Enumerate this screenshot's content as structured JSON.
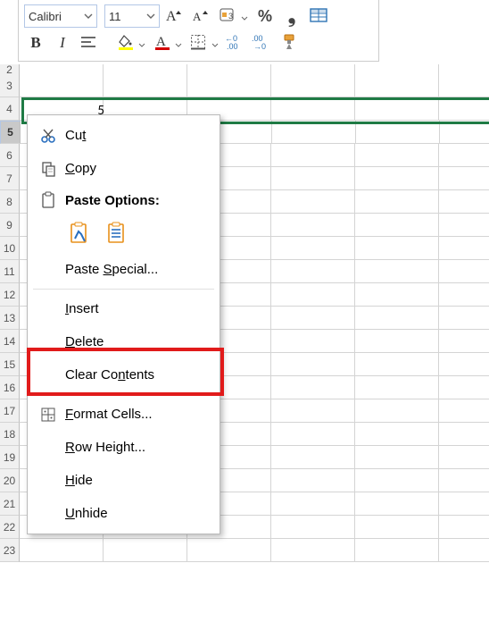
{
  "floatie": {
    "font": "Calibri",
    "size": "11",
    "boldGlyph": "B",
    "italicGlyph": "I",
    "percentGlyph": "%",
    "commaGlyph": "❟"
  },
  "rows": {
    "start": 2,
    "end": 23,
    "selected": 5
  },
  "selectedCellValue": "5",
  "menu": {
    "cut": "Cu<u>t</u>",
    "copy": "<u>C</u>opy",
    "pasteOptions": "Paste Options:",
    "pasteSpecial": "Paste <u>S</u>pecial...",
    "insert": "<u>I</u>nsert",
    "delete": "<u>D</u>elete",
    "clear": "Clear Co<u>n</u>tents",
    "formatCells": "<u>F</u>ormat Cells...",
    "rowHeight": "<u>R</u>ow Height...",
    "hide": "<u>H</u>ide",
    "unhide": "<u>U</u>nhide"
  }
}
